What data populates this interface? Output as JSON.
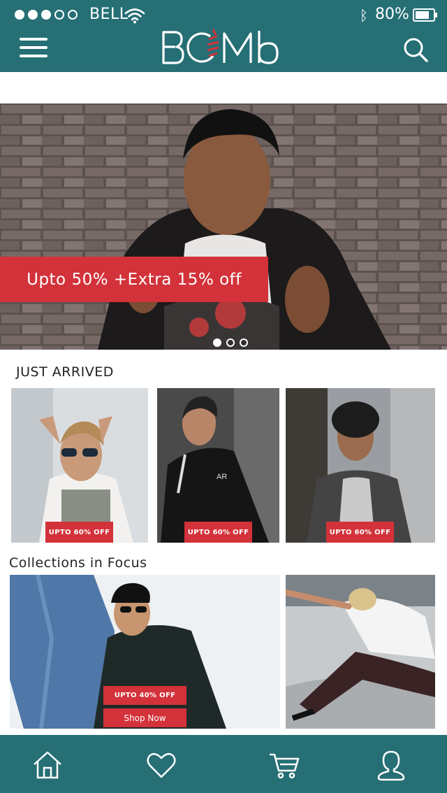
{
  "status_bar": {
    "carrier": "BELL",
    "battery_percent": "80%",
    "signal_bars_filled": 3,
    "signal_bars_total": 5
  },
  "header": {
    "logo_text": "BOMb",
    "icons": [
      "menu-icon",
      "search-icon"
    ]
  },
  "hero": {
    "promo_text": "Upto 50% +Extra 15% off",
    "carousel_dots": 3,
    "active_dot": 0
  },
  "just_arrived": {
    "title": "JUST ARRIVED",
    "items": [
      {
        "badge": "UPTO 60% OFF"
      },
      {
        "badge": "UPTO 60% OFF"
      },
      {
        "badge": "UPTO 60% OFF"
      }
    ]
  },
  "collections": {
    "title": "Collections in Focus",
    "feature": {
      "badge": "UPTO 40% OFF",
      "cta": "Shop Now"
    }
  },
  "bottom_nav": {
    "items": [
      "home-icon",
      "heart-icon",
      "cart-icon",
      "user-icon"
    ]
  },
  "colors": {
    "brand_teal": "#256f75",
    "accent_red": "#d3323a"
  }
}
